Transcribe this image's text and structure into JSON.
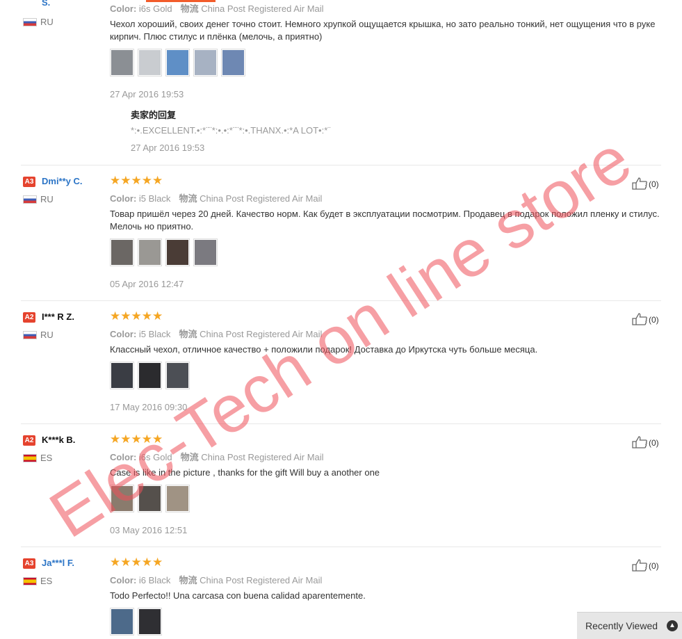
{
  "reviews": [
    {
      "badge": "",
      "name": "S.",
      "country": "RU",
      "flag": "ru",
      "color_label": "Color:",
      "color_value": "i6s Gold",
      "ship_label": "物流",
      "ship_value": "China Post Registered Air Mail",
      "text": "Чехол хороший, своих денег точно стоит. Немного хрупкой ощущается крышка, но зато реально тонкий, нет ощущения что в руке кирпич. Плюс стилус и плёнка (мелочь, а приятно)",
      "date": "27 Apr 2016 19:53",
      "thumb_colors": [
        "#8b8f94",
        "#c9ccd0",
        "#5f8fc6",
        "#a7b2c3",
        "#6e88b3"
      ],
      "seller_reply": {
        "title": "卖家的回复",
        "text": "*:•.EXCELLENT.•:*¨¨*:•.•:*¨¨*:•.THANX.•:*A LOT•:*¨",
        "date": "27 Apr 2016 19:53"
      }
    },
    {
      "badge": "A3",
      "name": "Dmi**y C.",
      "country": "RU",
      "flag": "ru",
      "stars": "★★★★★",
      "color_label": "Color:",
      "color_value": "i5 Black",
      "ship_label": "物流",
      "ship_value": "China Post Registered Air Mail",
      "text": "Товар пришёл через 20 дней. Качество норм. Как будет в эксплуатации посмотрим. Продавец в подарок положил пленку и стилус. Мелочь но приятно.",
      "date": "05 Apr 2016 12:47",
      "helpful": "(0)",
      "thumb_colors": [
        "#6b6764",
        "#9a9894",
        "#4a3c36",
        "#7b7a80"
      ]
    },
    {
      "badge": "A2",
      "name": "I*** R Z.",
      "country": "RU",
      "flag": "ru",
      "stars": "★★★★★",
      "color_label": "Color:",
      "color_value": "i5 Black",
      "ship_label": "物流",
      "ship_value": "China Post Registered Air Mail",
      "text": "Классный чехол, отличное качество + положили подарок! Доставка до Иркутска чуть больше месяца.",
      "date": "17 May 2016 09:30",
      "helpful": "(0)",
      "thumb_colors": [
        "#3a3d44",
        "#2b2b2e",
        "#4c4f55"
      ]
    },
    {
      "badge": "A2",
      "name": "K***k B.",
      "country": "ES",
      "flag": "es",
      "stars": "★★★★★",
      "color_label": "Color:",
      "color_value": "i6s Gold",
      "ship_label": "物流",
      "ship_value": "China Post Registered Air Mail",
      "text": "Case is like in the picture , thanks for the gift Will buy a another one",
      "date": "03 May 2016 12:51",
      "helpful": "(0)",
      "thumb_colors": [
        "#8a7b6d",
        "#55504c",
        "#a09384"
      ]
    },
    {
      "badge": "A3",
      "name": "Ja***l F.",
      "country": "ES",
      "flag": "es",
      "stars": "★★★★★",
      "color_label": "Color:",
      "color_value": "i6 Black",
      "ship_label": "物流",
      "ship_value": "China Post Registered Air Mail",
      "text": "Todo Perfecto!! Una carcasa con buena calidad aparentemente.",
      "helpful": "(0)",
      "thumb_colors": [
        "#4d6a8a",
        "#2f2f33"
      ]
    }
  ],
  "watermark": "Elec-Tech on line store",
  "recently_viewed": "Recently Viewed",
  "colors": {
    "accent": "#f25c2b",
    "badge": "#e5432e",
    "star": "#f5a623",
    "link": "#2b74c6",
    "watermark": "#ee505a"
  }
}
